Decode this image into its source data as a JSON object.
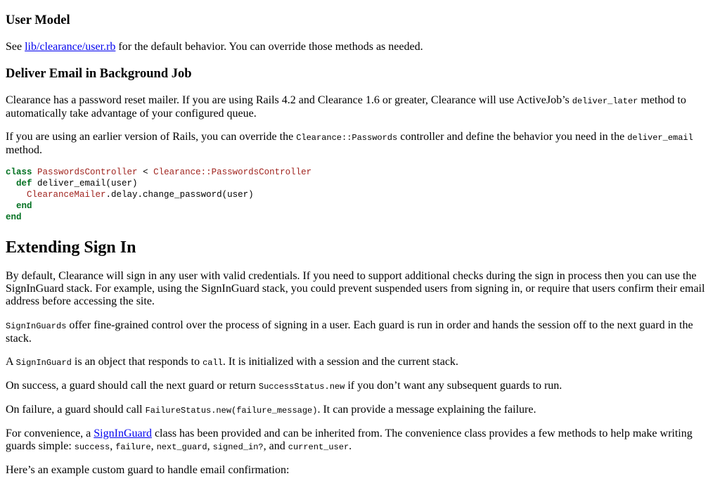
{
  "sections": {
    "user_model": {
      "heading": "User Model",
      "p1": {
        "prefix": "See ",
        "link": "lib/clearance/user.rb",
        "suffix": " for the default behavior. You can override those methods as needed."
      }
    },
    "deliver_email": {
      "heading": "Deliver Email in Background Job",
      "p1": {
        "t1": "Clearance has a password reset mailer. If you are using Rails 4.2 and Clearance 1.6 or greater, Clearance will use ActiveJob’s ",
        "c1": "deliver_later",
        "t2": " method to automatically take advantage of your configured queue."
      },
      "p2": {
        "t1": "If you are using an earlier version of Rails, you can override the ",
        "c1": "Clearance::Passwords",
        "t2": " controller and define the behavior you need in the ",
        "c2": "deliver_email",
        "t3": " method."
      },
      "code": {
        "l1_kw": "class",
        "l1_cls": "PasswordsController",
        "l1_op": " < ",
        "l1_parent": "Clearance::PasswordsController",
        "l2_kw": "def",
        "l2_rest": " deliver_email(user)",
        "l3_cls": "ClearanceMailer",
        "l3_rest": ".delay.change_password(user)",
        "l4_kw": "end",
        "l5_kw": "end"
      }
    },
    "extending": {
      "heading": "Extending Sign In",
      "p1": "By default, Clearance will sign in any user with valid credentials. If you need to support additional checks during the sign in process then you can use the SignInGuard stack. For example, using the SignInGuard stack, you could prevent suspended users from signing in, or require that users confirm their email address before accessing the site.",
      "p2": {
        "c1": "SignInGuards",
        "t1": " offer fine-grained control over the process of signing in a user. Each guard is run in order and hands the session off to the next guard in the stack."
      },
      "p3": {
        "t1": "A ",
        "c1": "SignInGuard",
        "t2": " is an object that responds to ",
        "c2": "call",
        "t3": ". It is initialized with a session and the current stack."
      },
      "p4": {
        "t1": "On success, a guard should call the next guard or return ",
        "c1": "SuccessStatus.new",
        "t2": " if you don’t want any subsequent guards to run."
      },
      "p5": {
        "t1": "On failure, a guard should call ",
        "c1": "FailureStatus.new(failure_message)",
        "t2": ". It can provide a message explaining the failure."
      },
      "p6": {
        "t1": "For convenience, a ",
        "link": "SignInGuard",
        "t2": " class has been provided and can be inherited from. The convenience class provides a few methods to help make writing guards simple: ",
        "c1": "success",
        "s1": ", ",
        "c2": "failure",
        "s2": ", ",
        "c3": "next_guard",
        "s3": ", ",
        "c4": "signed_in?",
        "s4": ", and ",
        "c5": "current_user",
        "s5": "."
      },
      "p7": "Here’s an example custom guard to handle email confirmation:"
    }
  }
}
